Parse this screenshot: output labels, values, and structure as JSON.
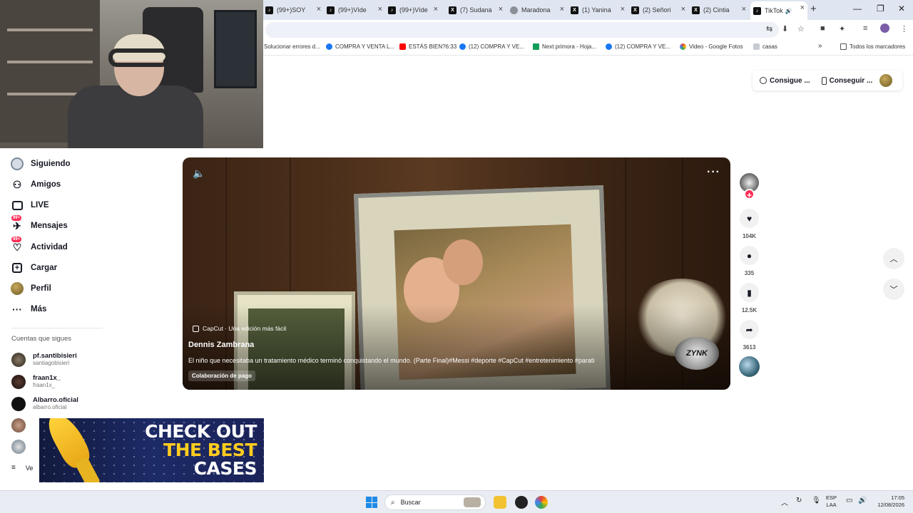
{
  "browser": {
    "tabs": [
      {
        "title": "(99+)SOY",
        "icon": "tiktok"
      },
      {
        "title": "(99+)Víde",
        "icon": "tiktok"
      },
      {
        "title": "(99+)Víde",
        "icon": "tiktok"
      },
      {
        "title": "(7) Sudana",
        "icon": "x"
      },
      {
        "title": "Maradona",
        "icon": "globe"
      },
      {
        "title": "(1) Yanina",
        "icon": "x"
      },
      {
        "title": "(2) Señori",
        "icon": "x"
      },
      {
        "title": "(2) Cintia",
        "icon": "x"
      },
      {
        "title": "TikTok",
        "icon": "tiktok"
      }
    ],
    "new_tab": "+",
    "bookmarks": [
      {
        "label": "Solucionar errores d..."
      },
      {
        "label": "COMPRA Y VENTA L..."
      },
      {
        "label": "ESTÁS BIEN?6:33"
      },
      {
        "label": "(12) COMPRA Y VE..."
      },
      {
        "label": "Next primora - Hoja..."
      },
      {
        "label": "(12) COMPRA Y VE..."
      },
      {
        "label": "Video - Google Fotos"
      },
      {
        "label": "casas"
      }
    ],
    "bookmarks_overflow": "»",
    "all_bookmarks": "Todos los marcadores"
  },
  "header": {
    "get_coins": "Consigue ...",
    "get_app": "Conseguir ..."
  },
  "sidebar": {
    "nav": [
      {
        "label": "Siguiendo",
        "icon": "following-icon"
      },
      {
        "label": "Amigos",
        "icon": "friends-icon"
      },
      {
        "label": "LIVE",
        "icon": "live-icon"
      },
      {
        "label": "Mensajes",
        "icon": "messages-icon",
        "badge": "99+"
      },
      {
        "label": "Actividad",
        "icon": "activity-icon",
        "badge": "99+"
      },
      {
        "label": "Cargar",
        "icon": "upload-icon"
      },
      {
        "label": "Perfil",
        "icon": "profile-icon"
      },
      {
        "label": "Más",
        "icon": "more-icon"
      }
    ],
    "following_title": "Cuentas que sigues",
    "accounts": [
      {
        "name": "pf.santibisieri",
        "username": "santiagobisieri"
      },
      {
        "name": "fraan1x_",
        "username": "fraan1x_"
      },
      {
        "name": "Albarro.oficial",
        "username": "albarro.oficial"
      }
    ],
    "see_more": "Ve"
  },
  "video": {
    "capcut_label": "CapCut · Una edición más fácil",
    "author": "Dennis Zambrana",
    "description": "El niño que necesitaba un tratamiento médico terminó conquistando el mundo. (Parte Final)#Messi #deporte #CapCut #entretenimiento #parati",
    "paid_label": "Colaboración de pago",
    "watermark": "ZYNK"
  },
  "actions": {
    "likes": "104K",
    "comments": "335",
    "saves": "12.5K",
    "shares": "3613"
  },
  "ad": {
    "line1": "CHECK OUT",
    "line2": "THE BEST",
    "line3": "CASES"
  },
  "taskbar": {
    "search_placeholder": "Buscar",
    "lang_top": "ESP",
    "lang_bottom": "LAA",
    "time": "17:05",
    "date": "12/08/2026"
  },
  "colors": {
    "accent": "#fe2c55",
    "ad_yellow": "#ffcc1f"
  }
}
